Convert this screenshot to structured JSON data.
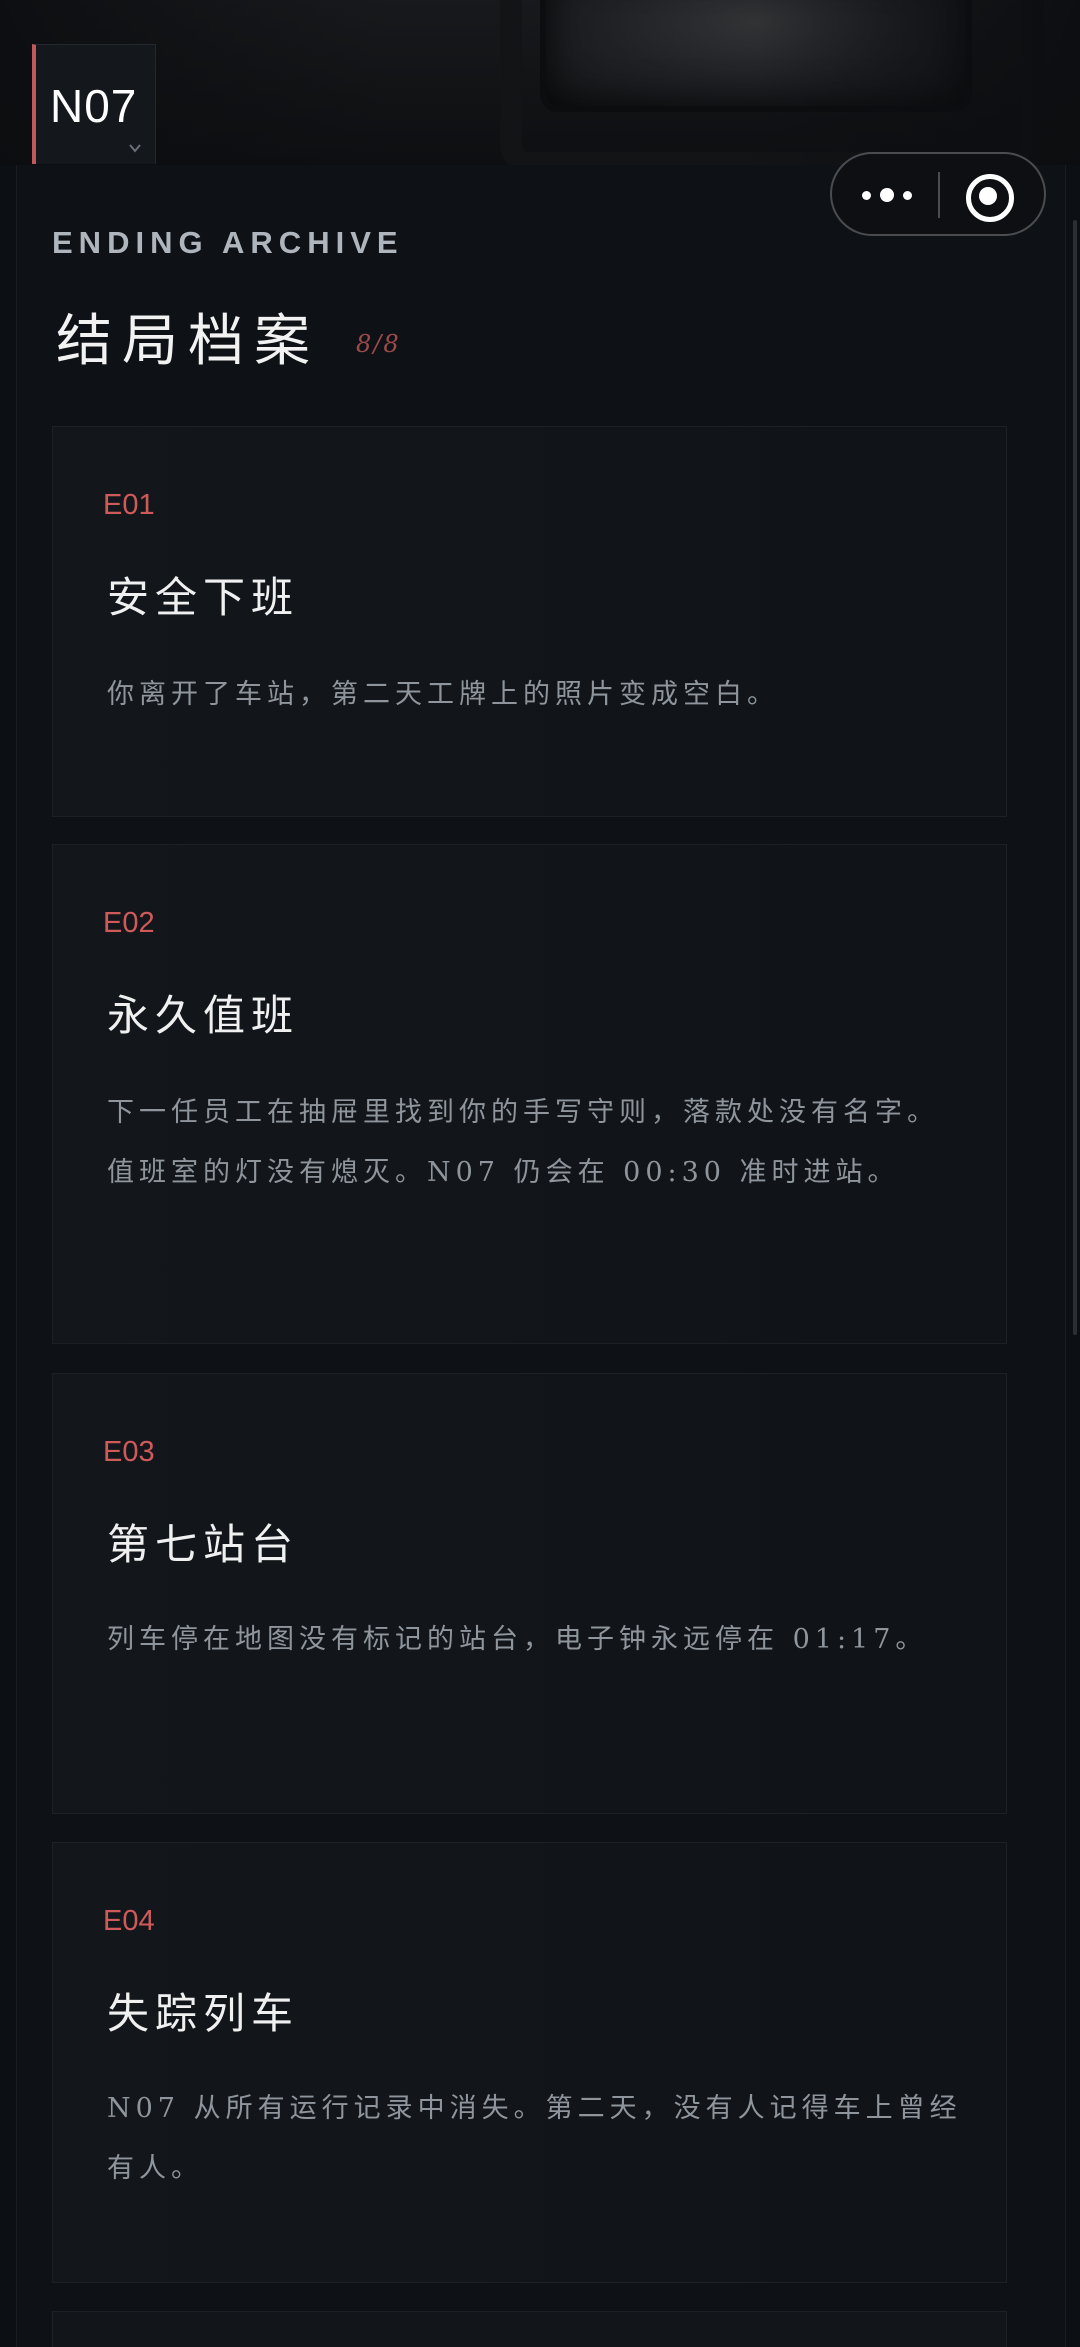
{
  "header": {
    "train_code": "N07"
  },
  "archive": {
    "eyebrow": "ENDING ARCHIVE",
    "title": "结局档案",
    "count": "8/8"
  },
  "endings": [
    {
      "id": "E01",
      "title": "安全下班",
      "description": "你离开了车站，第二天工牌上的照片变成空白。"
    },
    {
      "id": "E02",
      "title": "永久值班",
      "description": "下一任员工在抽屉里找到你的手写守则，落款处没有名字。值班室的灯没有熄灭。N07 仍会在 00:30 准时进站。"
    },
    {
      "id": "E03",
      "title": "第七站台",
      "description": "列车停在地图没有标记的站台，电子钟永远停在 01:17。"
    },
    {
      "id": "E04",
      "title": "失踪列车",
      "description": "N07 从所有运行记录中消失。第二天，没有人记得车上曾经有人。"
    }
  ],
  "icons": {
    "more": "more-dots-icon",
    "close": "target-close-icon",
    "dropdown": "chevron-down-icon"
  },
  "colors": {
    "accent": "#cf5a5a",
    "background": "#0b0d10",
    "card": "#12161a"
  }
}
